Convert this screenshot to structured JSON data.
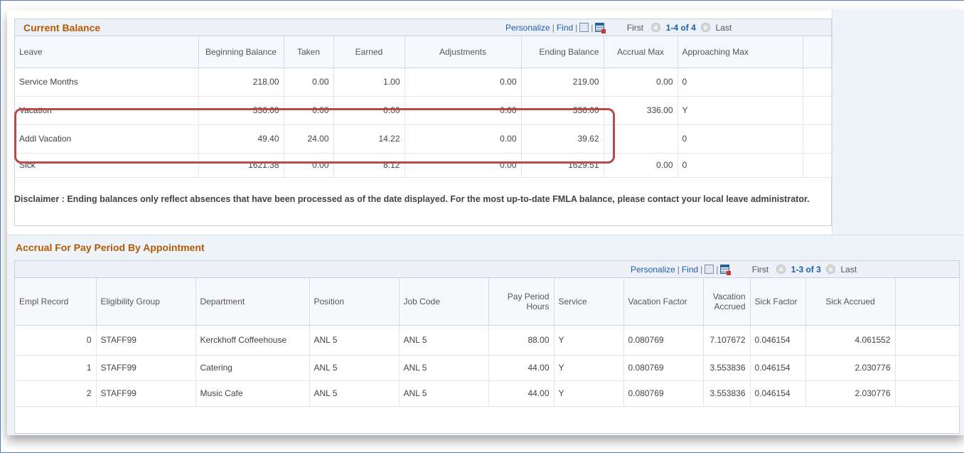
{
  "current_balance": {
    "title": "Current Balance",
    "nav": {
      "personalize": "Personalize",
      "find": "Find",
      "first": "First",
      "range": "1-4 of 4",
      "last": "Last"
    },
    "columns": [
      "Leave",
      "Beginning Balance",
      "Taken",
      "Earned",
      "Adjustments",
      "Ending Balance",
      "Accrual Max",
      "Approaching Max"
    ],
    "rows": [
      {
        "leave": "Service Months",
        "beginning": "218.00",
        "taken": "0.00",
        "earned": "1.00",
        "adjustments": "0.00",
        "ending": "219.00",
        "accrual_max": "0.00",
        "approaching": "0"
      },
      {
        "leave": "Vacation",
        "beginning": "336.00",
        "taken": "0.00",
        "earned": "0.00",
        "adjustments": "0.00",
        "ending": "336.00",
        "accrual_max": "336.00",
        "approaching": "Y"
      },
      {
        "leave": "Addl Vacation",
        "beginning": "49.40",
        "taken": "24.00",
        "earned": "14.22",
        "adjustments": "0.00",
        "ending": "39.62",
        "accrual_max": "",
        "approaching": "0"
      },
      {
        "leave": "Sick",
        "beginning": "1621.38",
        "taken": "0.00",
        "earned": "8.12",
        "adjustments": "0.00",
        "ending": "1629.51",
        "accrual_max": "0.00",
        "approaching": "0"
      }
    ]
  },
  "disclaimer": "Disclaimer : Ending balances only reflect absences that have been processed as of the date displayed. For the most up-to-date FMLA balance, please contact your local leave administrator.",
  "accrual": {
    "title": "Accrual For Pay Period By Appointment",
    "nav": {
      "personalize": "Personalize",
      "find": "Find",
      "first": "First",
      "range": "1-3 of 3",
      "last": "Last"
    },
    "columns": [
      "Empl Record",
      "Eligibility Group",
      "Department",
      "Position",
      "Job Code",
      "Pay Period Hours",
      "Service",
      "Vacation Factor",
      "Vacation Accrued",
      "Sick Factor",
      "Sick Accrued"
    ],
    "rows": [
      {
        "empl": "0",
        "group": "STAFF99",
        "dept": "Kerckhoff Coffeehouse",
        "position": "ANL 5",
        "job": "ANL 5",
        "hours": "88.00",
        "service": "Y",
        "vac_factor": "0.080769",
        "vac_accrued": "7.107672",
        "sick_factor": "0.046154",
        "sick_accrued": "4.061552"
      },
      {
        "empl": "1",
        "group": "STAFF99",
        "dept": "Catering",
        "position": "ANL 5",
        "job": "ANL 5",
        "hours": "44.00",
        "service": "Y",
        "vac_factor": "0.080769",
        "vac_accrued": "3.553836",
        "sick_factor": "0.046154",
        "sick_accrued": "2.030776"
      },
      {
        "empl": "2",
        "group": "STAFF99",
        "dept": "Music Cafe",
        "position": "ANL 5",
        "job": "ANL 5",
        "hours": "44.00",
        "service": "Y",
        "vac_factor": "0.080769",
        "vac_accrued": "3.553836",
        "sick_factor": "0.046154",
        "sick_accrued": "2.030776"
      }
    ]
  },
  "icons": {
    "zoom": "zoom-icon",
    "download": "download-grid-icon",
    "first_arrow": "previous-arrow-icon",
    "last_arrow": "next-arrow-icon"
  },
  "colors": {
    "section_title": "#b35a00",
    "link": "#1b5eb0",
    "highlight_border": "#b84a4a",
    "panel_bg": "#eef3fa"
  }
}
